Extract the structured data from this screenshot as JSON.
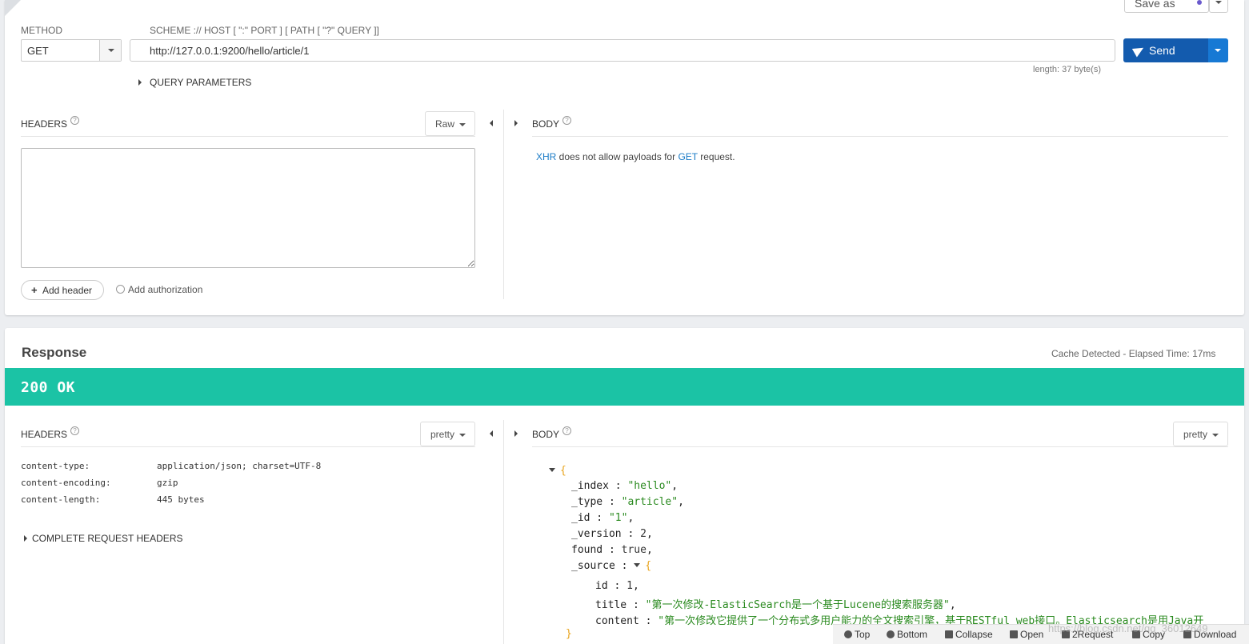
{
  "request": {
    "method_label": "METHOD",
    "scheme_label": "SCHEME :// HOST [ \":\" PORT ] [ PATH [ \"?\" QUERY ]]",
    "method": "GET",
    "url": "http://127.0.0.1:9200/hello/article/1",
    "length": "length: 37 byte(s)",
    "send_label": "Send",
    "save_as_label": "Save as",
    "query_params_label": "QUERY PARAMETERS",
    "headers_label": "HEADERS",
    "headers_format": "Raw",
    "body_label": "BODY",
    "add_header_label": "Add header",
    "add_auth_label": "Add authorization",
    "body_msg": {
      "xhr": "XHR",
      "middle": " does not allow payloads for ",
      "get": "GET",
      "end": " request."
    }
  },
  "response": {
    "title": "Response",
    "elapsed": "Cache Detected - Elapsed Time: 17ms",
    "status": "200 OK",
    "headers_label": "HEADERS",
    "headers_format": "pretty",
    "body_label": "BODY",
    "body_format": "pretty",
    "headers": [
      {
        "key": "content-type:",
        "value": "application/json; charset=UTF-8"
      },
      {
        "key": "content-encoding:",
        "value": "gzip"
      },
      {
        "key": "content-length:",
        "value": "445 bytes"
      }
    ],
    "complete_headers_label": "COMPLETE REQUEST HEADERS",
    "json": {
      "open_brace": "{",
      "close_brace": "}",
      "index_key": "_index",
      "index_val": "\"hello\"",
      "type_key": "_type",
      "type_val": "\"article\"",
      "id_key": "_id",
      "id_val": "\"1\"",
      "version_key": "_version",
      "version_val": "2",
      "found_key": "found",
      "found_val": "true",
      "source_key": "_source",
      "src_id_key": "id",
      "src_id_val": "1",
      "title_key": "title",
      "title_val": "\"第一次修改-ElasticSearch是一个基于Lucene的搜索服务器\"",
      "content_key": "content",
      "content_val": "\"第一次修改它提供了一个分布式多用户能力的全文搜索引擎，基于RESTful web接口。Elasticsearch是用Java开"
    }
  },
  "bottom_bar": {
    "top": "Top",
    "bottom": "Bottom",
    "collapse": "Collapse",
    "open": "Open",
    "request": "2Request",
    "copy": "Copy",
    "download": "Download"
  },
  "watermark": "https://blog.csdn.net/qq_36012649"
}
